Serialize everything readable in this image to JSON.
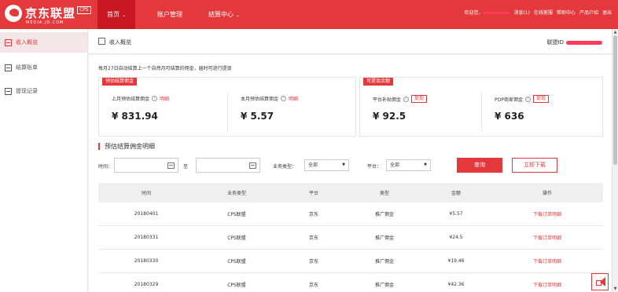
{
  "header": {
    "logo_text": "京东联盟",
    "logo_badge": "CPS",
    "logo_subtext": "MEDIA.JD.COM",
    "nav": [
      {
        "label": "首页",
        "caret": "⌄"
      },
      {
        "label": "账户管理",
        "caret": ""
      },
      {
        "label": "结算中心",
        "caret": "⌄"
      }
    ],
    "greeting": "欢迎您，",
    "messages": "消息(1)",
    "online_service": "在线客服",
    "help_center": "帮助中心",
    "product_intro": "产品介绍",
    "logout": "退出"
  },
  "sidebar": {
    "items": [
      {
        "label": "收入概览",
        "active": true
      },
      {
        "label": "结算账单",
        "active": false
      },
      {
        "label": "提现记录",
        "active": false
      }
    ]
  },
  "page": {
    "title": "收入概览",
    "union_id_label": "联盟ID"
  },
  "notice": "每月27日自动结算上一个自然月可结算的佣金，届时可进行提现",
  "estimated": {
    "tag": "预估结算佣金",
    "last_month_label": "上月预估结算佣金",
    "last_month_link": "明细",
    "last_month_value": "¥ 831.94",
    "this_month_label": "本月预估结算佣金",
    "this_month_link": "明细",
    "this_month_value": "¥ 5.57"
  },
  "withdrawable": {
    "tag": "可提现余额",
    "platform_label": "平台补贴佣金",
    "platform_button": "提现",
    "platform_value": "¥ 92.5",
    "pop_label": "POP商家佣金",
    "pop_button": "提现",
    "pop_value": "¥ 636"
  },
  "section_title": "预估结算佣金明细",
  "filters": {
    "time_label": "时间：",
    "to_label": "至",
    "business_type_label": "业务类型：",
    "business_type_value": "全部",
    "platform_label": "平台：",
    "platform_value": "全部",
    "query_button": "查询",
    "download_button": "立即下载"
  },
  "table": {
    "columns": [
      "时间",
      "业务类型",
      "平台",
      "类型",
      "金额",
      "操作"
    ],
    "rows": [
      {
        "date": "20180401",
        "business": "CPS联盟",
        "platform": "京东",
        "type": "推广佣金",
        "amount": "¥5.57",
        "action": "下载订单明细"
      },
      {
        "date": "20180331",
        "business": "CPS联盟",
        "platform": "京东",
        "type": "推广佣金",
        "amount": "¥24.5",
        "action": "下载订单明细"
      },
      {
        "date": "20180330",
        "business": "CPS联盟",
        "platform": "京东",
        "type": "推广佣金",
        "amount": "¥19.46",
        "action": "下载订单明细"
      },
      {
        "date": "20180329",
        "business": "CPS联盟",
        "platform": "京东",
        "type": "推广佣金",
        "amount": "¥42.36",
        "action": "下载订单明细"
      }
    ]
  },
  "icons": {
    "calendar": "calendar-icon",
    "help": "?",
    "dropdown": "▼",
    "scroll_up": "▲",
    "scroll_down": "▼"
  },
  "colors": {
    "brand_red": "#e4393c",
    "nav_active": "#c81623",
    "redaction": "#ff3b5c"
  }
}
